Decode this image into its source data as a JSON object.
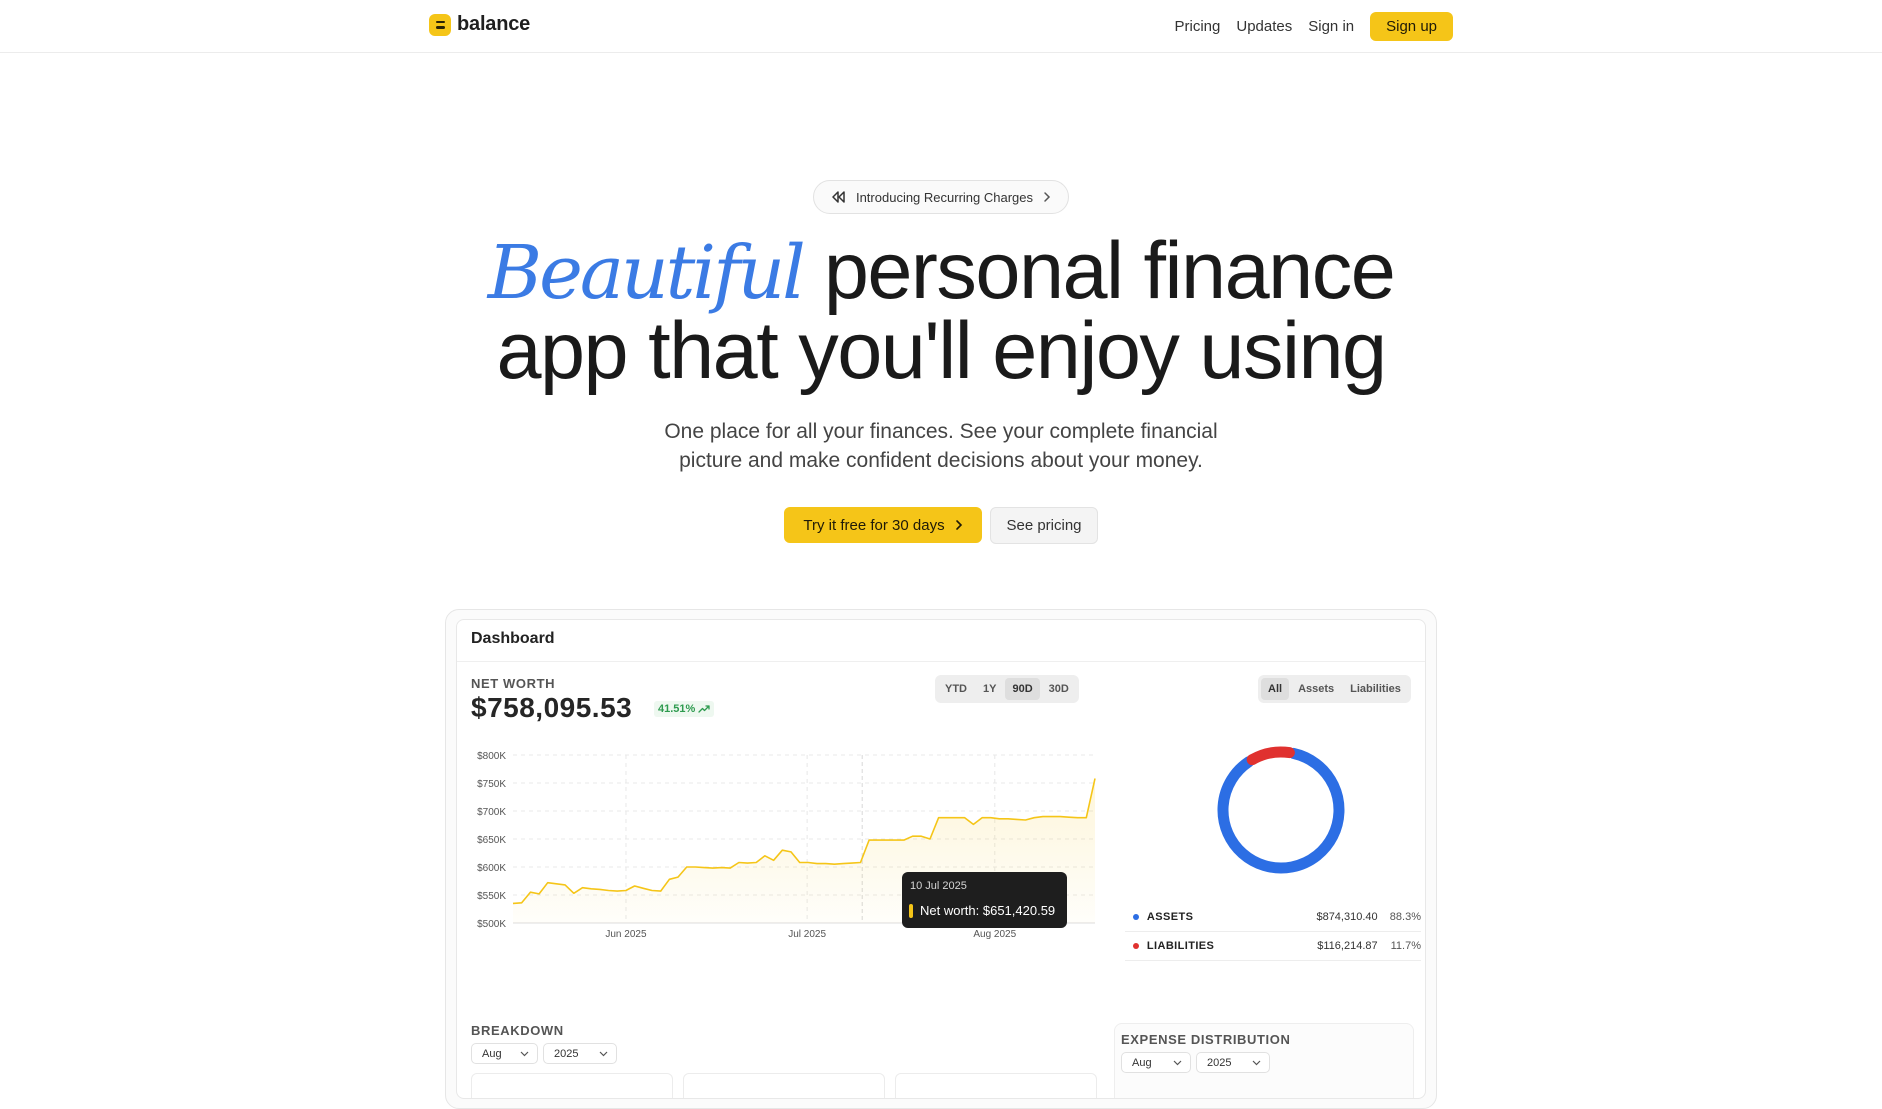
{
  "nav": {
    "logo": "balance",
    "links": [
      "Pricing",
      "Updates",
      "Sign in"
    ],
    "signup": "Sign up",
    "accent_color": "#f5c518"
  },
  "announcement": {
    "icon": "rewind-icon",
    "text": "Introducing Recurring Charges"
  },
  "hero": {
    "title_accent": "Beautiful",
    "title_line1_rest": "personal finance",
    "title_line2": "app that you'll enjoy using",
    "subtitle": "One place for all your finances. See your complete financial picture and make confident decisions about your money.",
    "cta_primary": "Try it free for 30 days",
    "cta_secondary": "See pricing",
    "accent_color": "#3b7be4"
  },
  "dashboard": {
    "title": "Dashboard",
    "net_worth_label": "NET WORTH",
    "net_worth_value": "$758,095.53",
    "net_worth_change": "41.51%",
    "ranges": [
      "YTD",
      "1Y",
      "90D",
      "30D"
    ],
    "active_range": "90D",
    "type_filters": [
      "All",
      "Assets",
      "Liabilities"
    ],
    "active_type": "All",
    "tooltip": {
      "date": "10 Jul 2025",
      "label": "Net worth: $651,420.59"
    },
    "legend": [
      {
        "name": "ASSETS",
        "amount": "$874,310.40",
        "percent": "88.3%",
        "color": "#2c6ee4"
      },
      {
        "name": "LIABILITIES",
        "amount": "$116,214.87",
        "percent": "11.7%",
        "color": "#e0312f"
      }
    ],
    "breakdown_label": "BREAKDOWN",
    "breakdown_month": "Aug",
    "breakdown_year": "2025",
    "expense_label": "EXPENSE DISTRIBUTION",
    "expense_month": "Aug",
    "expense_year": "2025"
  },
  "chart_data": [
    {
      "type": "area",
      "y_ticks": [
        "$800K",
        "$750K",
        "$700K",
        "$650K",
        "$600K",
        "$550K",
        "$500K"
      ],
      "ylim": [
        500000,
        800000
      ],
      "x_ticks": [
        "Jun 2025",
        "Jul 2025",
        "Aug 2025"
      ],
      "series": [
        {
          "values": [
            535000,
            536000,
            555000,
            552000,
            572000,
            570000,
            568000,
            553000,
            563000,
            561000,
            560000,
            558000,
            557000,
            558000,
            566000,
            562000,
            558000,
            557000,
            578000,
            582000,
            600000,
            600000,
            599000,
            598000,
            599000,
            598000,
            608000,
            607000,
            608000,
            620000,
            612000,
            630000,
            627000,
            608000,
            608000,
            606000,
            606000,
            605000,
            606000,
            607000,
            608000,
            648000,
            648000,
            648000,
            648000,
            648000,
            655000,
            655000,
            650000,
            688000,
            688000,
            688000,
            688000,
            676000,
            688000,
            688000,
            686000,
            686000,
            685000,
            684000,
            688000,
            690000,
            690000,
            690000,
            689000,
            688000,
            688000,
            758000
          ],
          "color": "#f5c518"
        }
      ],
      "grid": true
    },
    {
      "type": "pie",
      "categories": [
        "ASSETS",
        "LIABILITIES"
      ],
      "values": [
        88.3,
        11.7
      ],
      "colors": [
        "#2c6ee4",
        "#e0312f"
      ]
    }
  ]
}
